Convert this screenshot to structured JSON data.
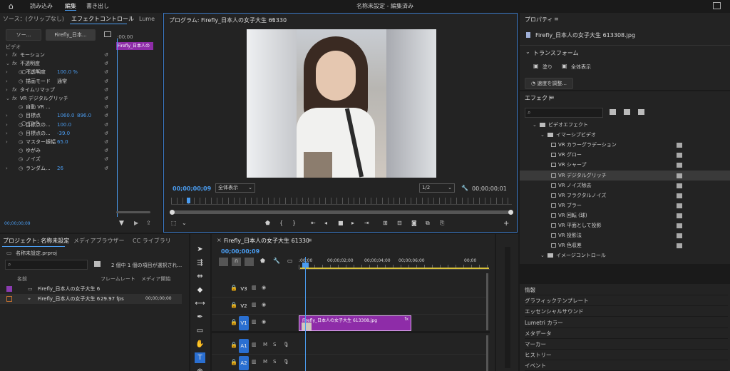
{
  "topbar": {
    "home_icon": "home-icon",
    "items": [
      "読み込み",
      "編集",
      "書き出し"
    ],
    "title": "名称未設定 - 編集済み"
  },
  "source_panel": {
    "tabs": [
      "ソース：(クリップなし)",
      "エフェクトコントロール",
      "Lume"
    ],
    "sub_tabs": [
      "ソー...",
      "Firefly_日本..."
    ],
    "clip_time": ":00;00",
    "clip_name": "Firefly_日本人の",
    "section": "ビデオ",
    "rows": [
      {
        "fx": "fx",
        "name": "モーション"
      },
      {
        "fx": "fx",
        "name": "不透明度"
      },
      {
        "fx": "",
        "name": "不透明度",
        "value": "100.0 %"
      },
      {
        "fx": "",
        "name": "描画モード",
        "value": "通常"
      },
      {
        "fx": "fx",
        "name": "タイムリマップ"
      },
      {
        "fx": "fx",
        "name": "VR デジタルグリッチ"
      },
      {
        "fx": "",
        "name": "自動 VR ..."
      },
      {
        "fx": "",
        "name": "目標点",
        "value": "1060.0",
        "value2": "896.0"
      },
      {
        "fx": "",
        "name": "目標点の...",
        "value": "100.0"
      },
      {
        "fx": "",
        "name": "目標点の...",
        "value": "-39.0"
      },
      {
        "fx": "",
        "name": "マスター振幅",
        "value": "65.0"
      },
      {
        "fx": "",
        "name": "ゆがみ"
      },
      {
        "fx": "",
        "name": "ノイズ"
      },
      {
        "fx": "",
        "name": "ランダム...",
        "value": "26"
      }
    ],
    "time": "00;00;00;09"
  },
  "program": {
    "title": "プログラム: Firefly_日本人の女子大生 61330",
    "timecode": "00;00;00;09",
    "fit": "全体表示",
    "resolution": "1/2",
    "duration": "00;00;00;01"
  },
  "properties": {
    "title": "プロパティ",
    "file": "Firefly_日本人の女子大生 613308.jpg",
    "transform": "トランスフォーム",
    "fill": "塗り",
    "fit_all": "全体表示",
    "speed_btn": "速度を調整..."
  },
  "effects": {
    "title": "エフェクト",
    "search_placeholder": "",
    "tree": [
      {
        "level": 0,
        "name": "ビデオエフェクト",
        "folder": true
      },
      {
        "level": 1,
        "name": "イマーシブビデオ",
        "folder": true
      },
      {
        "level": 2,
        "name": "VR カラーグラデーション"
      },
      {
        "level": 2,
        "name": "VR グロー"
      },
      {
        "level": 2,
        "name": "VR シャープ"
      },
      {
        "level": 2,
        "name": "VR デジタルグリッチ",
        "selected": true
      },
      {
        "level": 2,
        "name": "VR ノイズ除去"
      },
      {
        "level": 2,
        "name": "VR フラクタルノイズ"
      },
      {
        "level": 2,
        "name": "VR ブラー"
      },
      {
        "level": 2,
        "name": "VR 回転 (球)"
      },
      {
        "level": 2,
        "name": "VR 平面として投影"
      },
      {
        "level": 2,
        "name": "VR 投影法"
      },
      {
        "level": 2,
        "name": "VR 色収差"
      },
      {
        "level": 1,
        "name": "イメージコントロール",
        "folder": true
      }
    ]
  },
  "side_panels": [
    "情報",
    "グラフィックテンプレート",
    "エッセンシャルサウンド",
    "Lumetri カラー",
    "メタデータ",
    "マーカー",
    "ヒストリー",
    "イベント"
  ],
  "project": {
    "tabs": [
      "プロジェクト: 名称未設定",
      "メディアブラウザー",
      "CC ライブラリ"
    ],
    "file": "名称未設定.prproj",
    "selection": "2 個中 1 個の項目が選択され...",
    "col_name": "名前",
    "col_fps": "フレームレート",
    "col_start": "メディア開始",
    "items": [
      {
        "name": "Firefly_日本人の女子大生 6",
        "fps": "",
        "start": "",
        "color": "#8a3bb0"
      },
      {
        "name": "Firefly_日本人の女子大生 6",
        "fps": "29.97 fps",
        "start": "00;00;00;00",
        "color": "#c07030"
      }
    ]
  },
  "timeline": {
    "tab": "Firefly_日本人の女子大生 61330",
    "timecode": "00;00;00;09",
    "ruler": [
      ":00;00",
      "00;00;02;00",
      "00;00;04;00",
      "00;00;06;00",
      "00;00"
    ],
    "tracks": [
      {
        "name": "V3"
      },
      {
        "name": "V2"
      },
      {
        "name": "V1",
        "active": true
      },
      {
        "name": "A1",
        "active": true,
        "audio": true
      },
      {
        "name": "A2",
        "active": true,
        "audio": true
      }
    ],
    "clip": "Firefly_日本人の女子大生 613308.jpg",
    "clip_fx": "fx"
  },
  "tools": [
    "selection-tool-icon",
    "track-select-icon",
    "ripple-edit-icon",
    "razor-icon",
    "slip-icon",
    "pen-icon",
    "rectangle-icon",
    "hand-icon",
    "type-icon",
    "zoom-icon"
  ]
}
